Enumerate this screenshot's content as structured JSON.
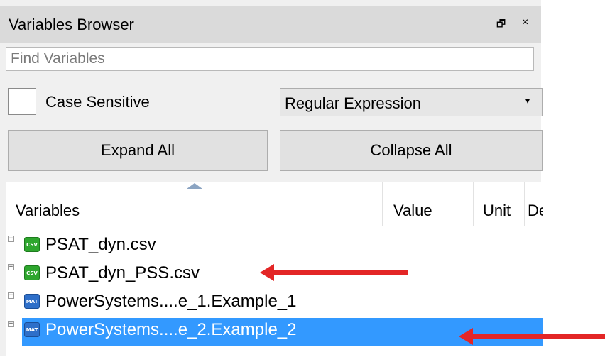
{
  "panel": {
    "title": "Variables Browser",
    "float_icon": "restore-window-icon",
    "float_glyph": "🗗",
    "close_glyph": "×"
  },
  "search": {
    "placeholder": "Find Variables",
    "value": ""
  },
  "case_sensitive": {
    "label": "Case Sensitive",
    "checked": false
  },
  "match_mode": {
    "selected": "Regular Expression",
    "arrow": "▾"
  },
  "buttons": {
    "expand_all": "Expand All",
    "collapse_all": "Collapse All"
  },
  "columns": {
    "variables": "Variables",
    "value": "Value",
    "unit": "Unit",
    "description": "Description"
  },
  "tree": {
    "rows": [
      {
        "label": "PSAT_dyn.csv",
        "icon": "csv-file-icon",
        "icon_text": "CSV",
        "expander": "+",
        "selected": false
      },
      {
        "label": "PSAT_dyn_PSS.csv",
        "icon": "csv-file-icon",
        "icon_text": "CSV",
        "expander": "+",
        "selected": false
      },
      {
        "label": "PowerSystems....e_1.Example_1",
        "icon": "mat-file-icon",
        "icon_text": "MAT",
        "expander": "+",
        "selected": false
      },
      {
        "label": "PowerSystems....e_2.Example_2",
        "icon": "mat-file-icon",
        "icon_text": "MAT",
        "expander": "+",
        "selected": true
      }
    ]
  },
  "colors": {
    "selection": "#3399ff",
    "annotation_arrow": "#e32626",
    "csv_icon": "#2ea62e",
    "mat_icon": "#2e6fc9"
  }
}
